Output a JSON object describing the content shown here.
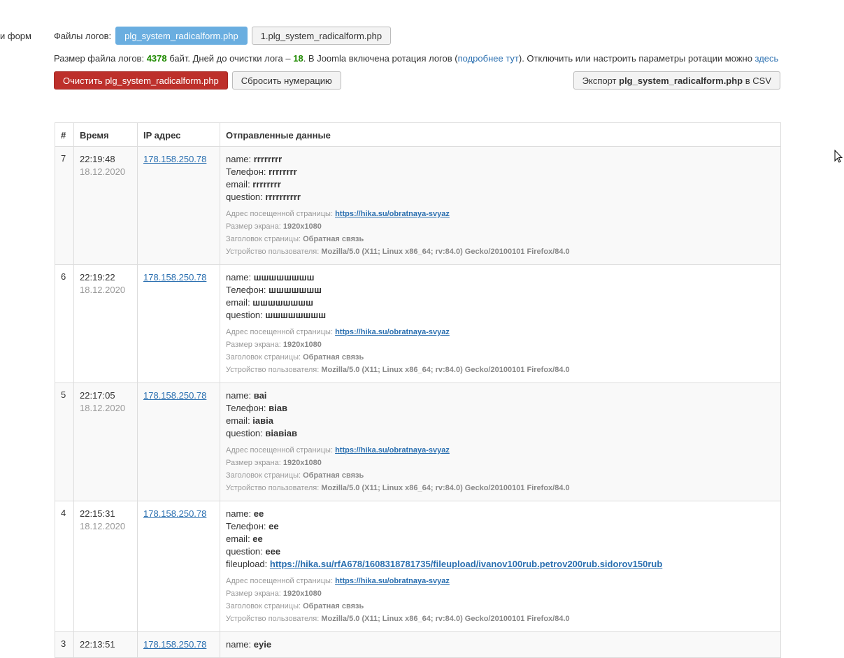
{
  "side_fragment": "и форм",
  "files": {
    "label": "Файлы логов:",
    "items": [
      "plg_system_radicalform.php",
      "1.plg_system_radicalform.php"
    ]
  },
  "info": {
    "p1": "Размер файла логов: ",
    "size": "4378",
    "p2": " байт. Дней до очистки лога – ",
    "days": "18",
    "p3": ". В Joomla включена ротация логов (",
    "link1": "подробнее тут",
    "p4": "). Отключить или настроить параметры ротации можно ",
    "link2": "здесь"
  },
  "actions": {
    "clear": "Очистить plg_system_radicalform.php",
    "reset": "Сбросить нумерацию",
    "export_pre": "Экспорт ",
    "export_file": "plg_system_radicalform.php",
    "export_post": " в CSV"
  },
  "table": {
    "headers": [
      "#",
      "Время",
      "IP адрес",
      "Отправленные данные"
    ],
    "meta_labels": {
      "url": "Адрес посещенной страницы: ",
      "screen": "Размер экрана: ",
      "title": "Заголовок страницы: ",
      "ua": "Устройство пользователя: "
    },
    "rows": [
      {
        "n": "7",
        "time": "22:19:48",
        "date": "18.12.2020",
        "ip": "178.158.250.78",
        "fields": [
          [
            "name: ",
            "rrrrrrrr"
          ],
          [
            "Телефон: ",
            "rrrrrrrr"
          ],
          [
            "email: ",
            "rrrrrrrr"
          ],
          [
            "question: ",
            "rrrrrrrrrr"
          ]
        ],
        "url": "https://hika.su/obratnaya-svyaz",
        "screen": "1920x1080",
        "title": "Обратная связь",
        "ua": "Mozilla/5.0 (X11; Linux x86_64; rv:84.0) Gecko/20100101 Firefox/84.0"
      },
      {
        "n": "6",
        "time": "22:19:22",
        "date": "18.12.2020",
        "ip": "178.158.250.78",
        "fields": [
          [
            "name: ",
            "шшшшшшшш"
          ],
          [
            "Телефон: ",
            "шшшшшшш"
          ],
          [
            "email: ",
            "шшшшшшшш"
          ],
          [
            "question: ",
            "шшшшшшшш"
          ]
        ],
        "url": "https://hika.su/obratnaya-svyaz",
        "screen": "1920x1080",
        "title": "Обратная связь",
        "ua": "Mozilla/5.0 (X11; Linux x86_64; rv:84.0) Gecko/20100101 Firefox/84.0"
      },
      {
        "n": "5",
        "time": "22:17:05",
        "date": "18.12.2020",
        "ip": "178.158.250.78",
        "fields": [
          [
            "name: ",
            "ваі"
          ],
          [
            "Телефон: ",
            "віав"
          ],
          [
            "email: ",
            "іавіа"
          ],
          [
            "question: ",
            "віавіав"
          ]
        ],
        "url": "https://hika.su/obratnaya-svyaz",
        "screen": "1920x1080",
        "title": "Обратная связь",
        "ua": "Mozilla/5.0 (X11; Linux x86_64; rv:84.0) Gecko/20100101 Firefox/84.0"
      },
      {
        "n": "4",
        "time": "22:15:31",
        "date": "18.12.2020",
        "ip": "178.158.250.78",
        "fields": [
          [
            "name: ",
            "ee"
          ],
          [
            "Телефон: ",
            "ee"
          ],
          [
            "email: ",
            "ee"
          ],
          [
            "question: ",
            "eee"
          ]
        ],
        "fileupload": [
          "fileupload: ",
          "https://hika.su/rfA678/1608318781735/fileupload/ivanov100rub.petrov200rub.sidorov150rub"
        ],
        "url": "https://hika.su/obratnaya-svyaz",
        "screen": "1920x1080",
        "title": "Обратная связь",
        "ua": "Mozilla/5.0 (X11; Linux x86_64; rv:84.0) Gecko/20100101 Firefox/84.0"
      },
      {
        "n": "3",
        "time": "22:13:51",
        "ip": "178.158.250.78",
        "fields": [
          [
            "name: ",
            "eyie"
          ]
        ]
      }
    ]
  }
}
